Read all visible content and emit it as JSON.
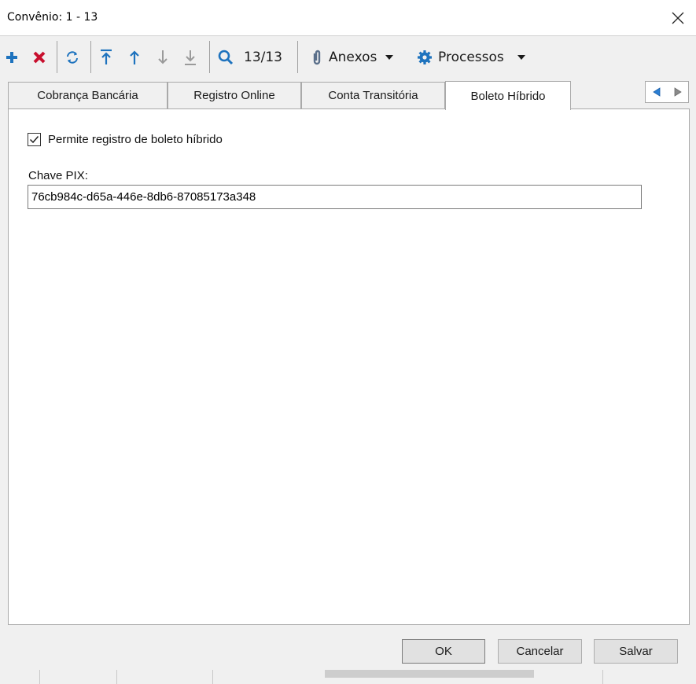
{
  "window": {
    "title": "Convênio: 1 - 13",
    "close_icon": "close-icon"
  },
  "toolbar": {
    "add_icon": "plus-icon",
    "delete_icon": "delete-x-icon",
    "refresh_icon": "refresh-icon",
    "first_icon": "first-record-icon",
    "prev_icon": "arrow-up-icon",
    "next_icon": "arrow-down-icon",
    "last_icon": "last-record-icon",
    "search_icon": "search-icon",
    "record_position": "13/13",
    "attachments_label": "Anexos",
    "processes_label": "Processos",
    "colors": {
      "add": "#1e73be",
      "delete": "#c8102e",
      "nav": "#1e73be",
      "disabled": "#9a9a9a"
    }
  },
  "tabs": {
    "items": [
      {
        "label": "Cobrança Bancária",
        "active": false
      },
      {
        "label": "Registro Online",
        "active": false
      },
      {
        "label": "Conta Transitória",
        "active": false
      },
      {
        "label": "Boleto Híbrido",
        "active": true
      }
    ],
    "scroll_left_icon": "triangle-left-icon",
    "scroll_right_icon": "triangle-right-icon"
  },
  "panel": {
    "checkbox_label": "Permite registro de boleto híbrido",
    "checkbox_checked": true,
    "pix_label": "Chave PIX:",
    "pix_value": "76cb984c-d65a-446e-8db6-87085173a348"
  },
  "buttons": {
    "ok": "OK",
    "cancel": "Cancelar",
    "save": "Salvar"
  }
}
